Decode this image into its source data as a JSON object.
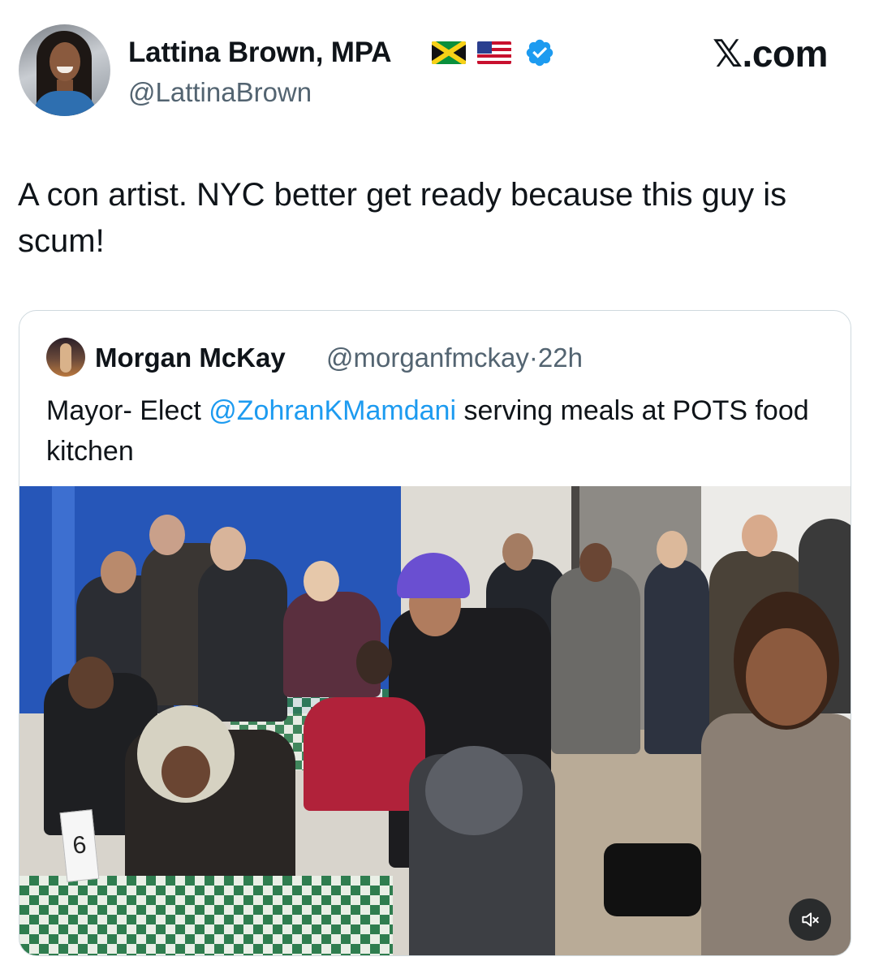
{
  "author": {
    "display_name": "Lattina Brown, MPA",
    "handle": "@LattinaBrown",
    "flags": [
      "jamaica-flag",
      "us-flag"
    ],
    "verified": true
  },
  "site_label": "𝕏.com",
  "tweet": {
    "text": "A con artist. NYC better get ready because this guy is scum!"
  },
  "quote": {
    "display_name": "Morgan McKay",
    "handle": "@morganfmckay",
    "separator": "·",
    "age": "22h",
    "text_before": "Mayor- Elect ",
    "mention": "@ZohranKMamdani",
    "text_after": " serving meals at POTS food kitchen",
    "media": {
      "kind": "video",
      "table_card": "6",
      "muted_icon": "speaker-muted-icon"
    }
  },
  "colors": {
    "text": "#0f1419",
    "secondary": "#536471",
    "link": "#1d9bf0",
    "verified": "#1d9bf0",
    "border": "#cfd9de"
  }
}
